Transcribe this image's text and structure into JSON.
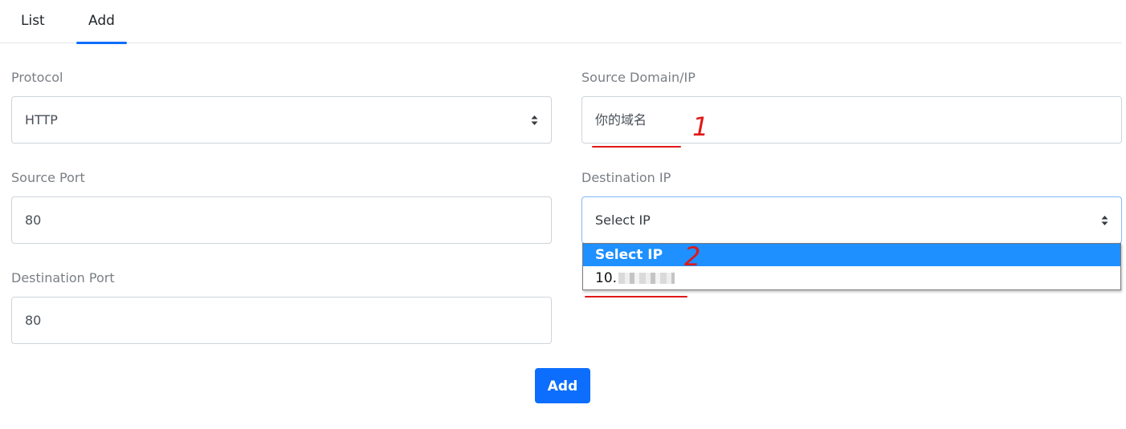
{
  "tabs": {
    "list_label": "List",
    "add_label": "Add",
    "active": "Add"
  },
  "form": {
    "protocol": {
      "label": "Protocol",
      "value": "HTTP"
    },
    "source_domain": {
      "label": "Source Domain/IP",
      "value": "你的域名"
    },
    "source_port": {
      "label": "Source Port",
      "value": "80"
    },
    "destination_ip": {
      "label": "Destination IP",
      "value": "Select IP",
      "options": [
        {
          "label": "Select IP",
          "selected": true
        },
        {
          "label": "10."
        }
      ]
    },
    "destination_port": {
      "label": "Destination Port",
      "value": "80"
    },
    "submit_label": "Add"
  },
  "annotations": {
    "marker_1": "1",
    "marker_2": "2",
    "color": "#e01818"
  },
  "colors": {
    "accent": "#0d6efd",
    "dropdown_highlight": "#1e90ff"
  }
}
